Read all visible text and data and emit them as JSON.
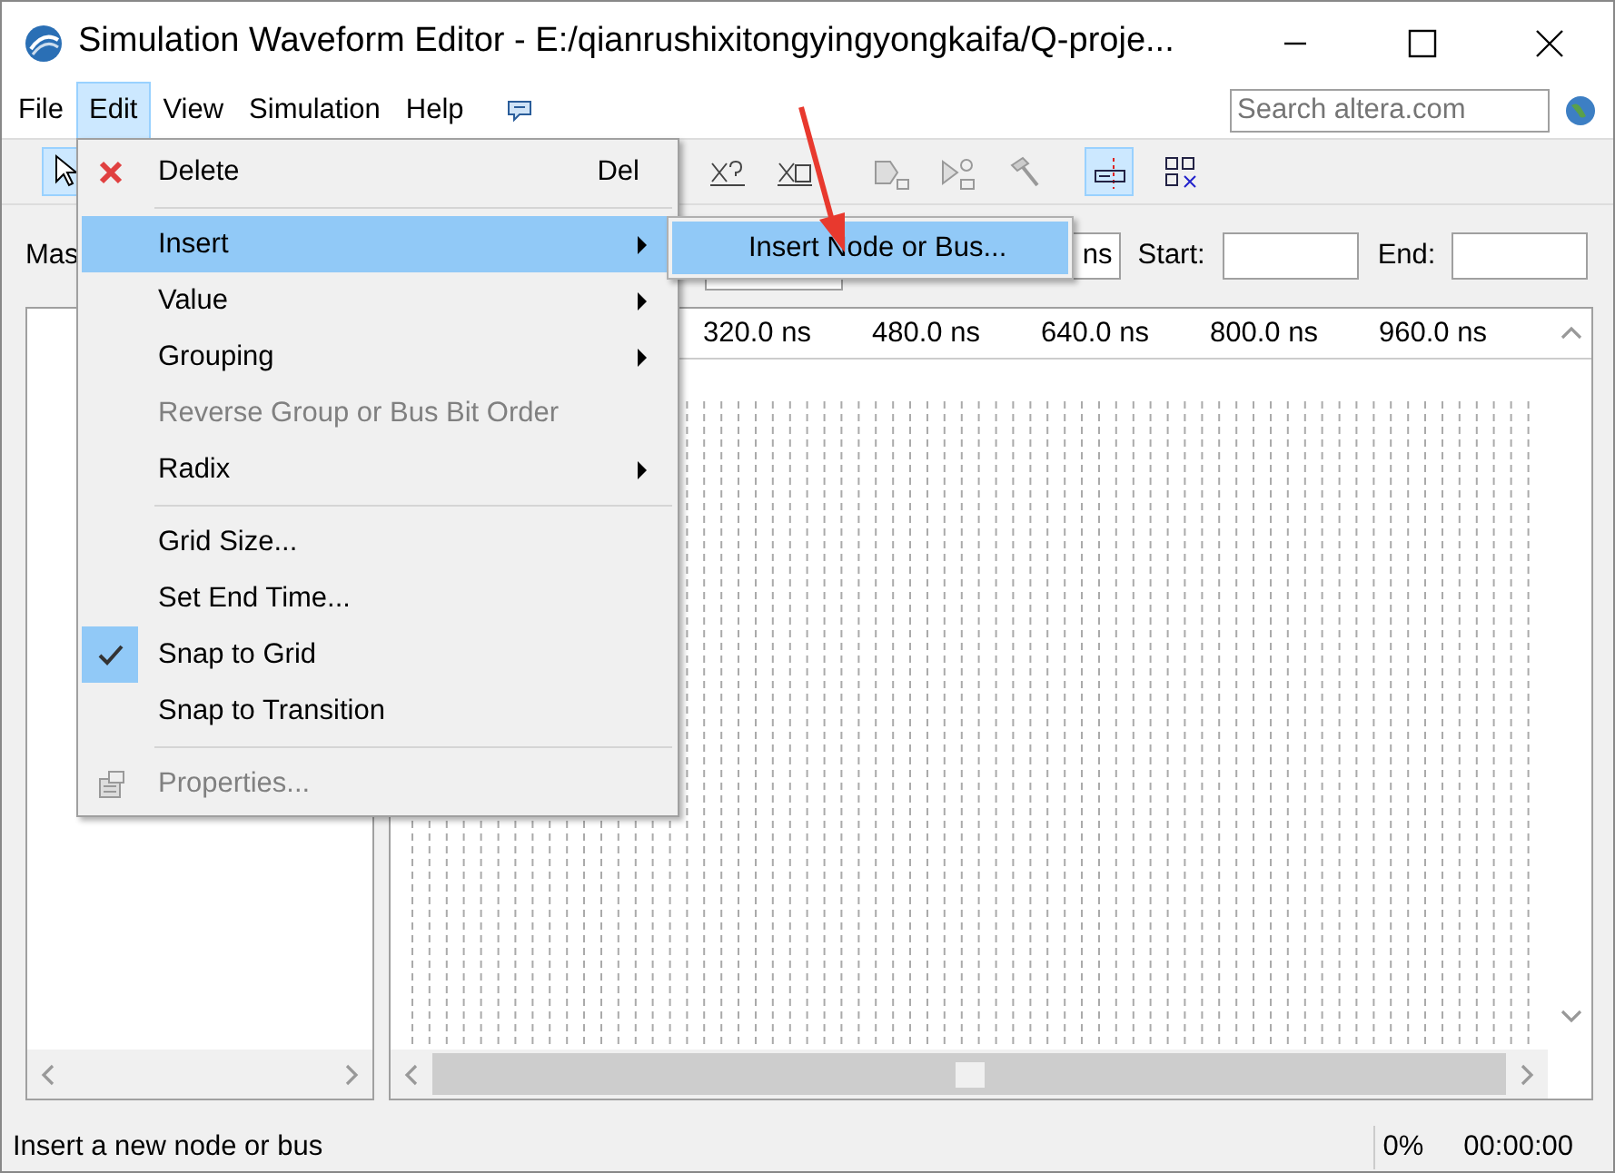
{
  "window": {
    "title": "Simulation Waveform Editor - E:/qianrushixitongyingyongkaifa/Q-proje..."
  },
  "menu_bar": [
    {
      "label": "File",
      "selected": false
    },
    {
      "label": "Edit",
      "selected": true
    },
    {
      "label": "View",
      "selected": false
    },
    {
      "label": "Simulation",
      "selected": false
    },
    {
      "label": "Help",
      "selected": false
    }
  ],
  "search": {
    "placeholder": "Search altera.com"
  },
  "toolbar": [
    {
      "kind": "pointer",
      "selected": true
    },
    {
      "kind": "x-unknown",
      "selected": false
    },
    {
      "kind": "x-random",
      "selected": false
    },
    {
      "kind": "node-a",
      "selected": false
    },
    {
      "kind": "node-b",
      "selected": false
    },
    {
      "kind": "hammer",
      "selected": false
    },
    {
      "kind": "snap",
      "selected": true
    },
    {
      "kind": "grid",
      "selected": false
    }
  ],
  "edit_menu": [
    {
      "kind": "delete",
      "label": "Delete",
      "shortcut": "Del",
      "selected": false,
      "disabled": false,
      "submenu": false,
      "checked": false
    },
    {
      "kind": "separator"
    },
    {
      "kind": "item",
      "label": "Insert",
      "selected": true,
      "disabled": false,
      "submenu": true,
      "checked": false
    },
    {
      "kind": "item",
      "label": "Value",
      "selected": false,
      "disabled": false,
      "submenu": true,
      "checked": false
    },
    {
      "kind": "item",
      "label": "Grouping",
      "selected": false,
      "disabled": false,
      "submenu": true,
      "checked": false
    },
    {
      "kind": "item",
      "label": "Reverse Group or Bus Bit Order",
      "selected": false,
      "disabled": true,
      "submenu": false,
      "checked": false
    },
    {
      "kind": "item",
      "label": "Radix",
      "selected": false,
      "disabled": false,
      "submenu": true,
      "checked": false
    },
    {
      "kind": "separator"
    },
    {
      "kind": "item",
      "label": "Grid Size...",
      "selected": false,
      "disabled": false,
      "submenu": false,
      "checked": false
    },
    {
      "kind": "item",
      "label": "Set End Time...",
      "selected": false,
      "disabled": false,
      "submenu": false,
      "checked": false
    },
    {
      "kind": "item",
      "label": "Snap to Grid",
      "selected": false,
      "disabled": false,
      "submenu": false,
      "checked": true
    },
    {
      "kind": "item",
      "label": "Snap to Transition",
      "selected": false,
      "disabled": false,
      "submenu": false,
      "checked": false
    },
    {
      "kind": "separator"
    },
    {
      "kind": "properties",
      "label": "Properties...",
      "selected": false,
      "disabled": true,
      "submenu": false,
      "checked": false
    }
  ],
  "insert_submenu": [
    {
      "label": "Insert Node or Bus...",
      "selected": true
    }
  ],
  "time_bar": {
    "label": "Mas",
    "unit_field": "ns",
    "start_label": "Start:",
    "end_label": "End:"
  },
  "timeline": [
    "320.0 ns",
    "480.0 ns",
    "640.0 ns",
    "800.0 ns",
    "960.0 ns"
  ],
  "status_bar": {
    "message": "Insert a new node or bus",
    "progress": "0%",
    "elapsed": "00:00:00"
  }
}
